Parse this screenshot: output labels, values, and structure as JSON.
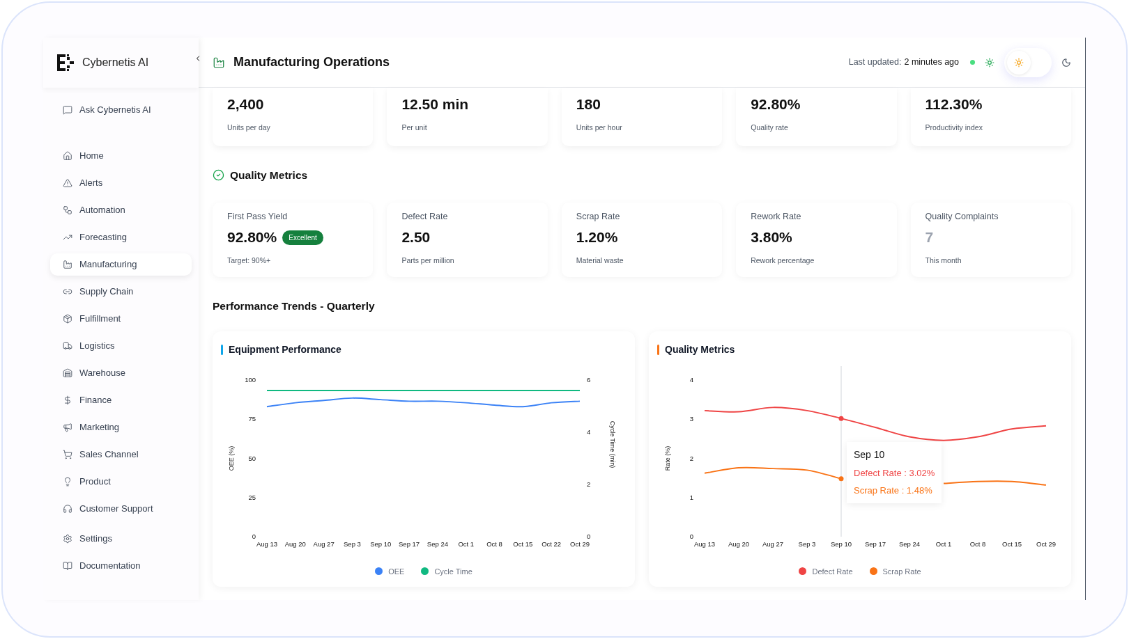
{
  "brand": {
    "name": "Cybernetis AI"
  },
  "sidebar": {
    "top_items": [
      {
        "label": "Ask Cybernetis AI",
        "selected": false
      }
    ],
    "items": [
      {
        "label": "Home",
        "selected": false
      },
      {
        "label": "Alerts",
        "selected": false
      },
      {
        "label": "Automation",
        "selected": false
      },
      {
        "label": "Forecasting",
        "selected": false
      },
      {
        "label": "Manufacturing",
        "selected": true
      },
      {
        "label": "Supply Chain",
        "selected": false
      },
      {
        "label": "Fulfillment",
        "selected": false
      },
      {
        "label": "Logistics",
        "selected": false
      },
      {
        "label": "Warehouse",
        "selected": false
      },
      {
        "label": "Finance",
        "selected": false
      },
      {
        "label": "Marketing",
        "selected": false
      },
      {
        "label": "Sales Channel",
        "selected": false
      },
      {
        "label": "Product",
        "selected": false
      },
      {
        "label": "Customer Support",
        "selected": false
      }
    ],
    "bottom_items": [
      {
        "label": "Settings",
        "selected": false
      },
      {
        "label": "Documentation",
        "selected": false
      }
    ]
  },
  "header": {
    "title": "Manufacturing Operations",
    "updated_label": "Last updated:",
    "updated_value": "2 minutes ago",
    "dark_mode": false
  },
  "production_cards": [
    {
      "value": "2,400",
      "sub": "Units per day"
    },
    {
      "value": "12.50 min",
      "sub": "Per unit"
    },
    {
      "value": "180",
      "sub": "Units per hour"
    },
    {
      "value": "92.80%",
      "sub": "Quality rate"
    },
    {
      "value": "112.30%",
      "sub": "Productivity index"
    }
  ],
  "quality": {
    "title": "Quality Metrics",
    "cards": [
      {
        "label": "First Pass Yield",
        "value": "92.80%",
        "badge": "Excellent",
        "sub": "Target: 90%+",
        "faded": false
      },
      {
        "label": "Defect Rate",
        "value": "2.50",
        "sub": "Parts per million",
        "faded": false
      },
      {
        "label": "Scrap Rate",
        "value": "1.20%",
        "sub": "Material waste",
        "faded": false
      },
      {
        "label": "Rework Rate",
        "value": "3.80%",
        "sub": "Rework percentage",
        "faded": false
      },
      {
        "label": "Quality Complaints",
        "value": "7",
        "sub": "This month",
        "faded": true
      }
    ]
  },
  "trends": {
    "title": "Performance Trends - Quarterly",
    "charts": [
      {
        "title": "Equipment Performance",
        "color": "#0ea5e9",
        "chart_data": {
          "type": "line",
          "ylabel": "OEE (%)",
          "y2label": "Cycle Time (min)",
          "categories": [
            "Aug 13",
            "Aug 20",
            "Aug 27",
            "Sep 3",
            "Sep 10",
            "Sep 17",
            "Sep 24",
            "Oct 1",
            "Oct 8",
            "Oct 15",
            "Oct 22",
            "Oct 29"
          ],
          "ylim": [
            0,
            100
          ],
          "yticks": [
            0,
            25,
            50,
            75,
            100
          ],
          "y2lim": [
            0,
            6
          ],
          "y2ticks": [
            0,
            2,
            4,
            6
          ],
          "series": [
            {
              "name": "OEE",
              "color": "#3b82f6",
              "values": [
                83,
                85.5,
                87,
                88.5,
                87.5,
                86.5,
                86.5,
                85.5,
                84,
                83,
                85.5,
                86.5
              ]
            },
            {
              "name": "Cycle Time",
              "color": "#10b981",
              "axis": "y2",
              "values": [
                5.6,
                5.6,
                5.6,
                5.6,
                5.6,
                5.6,
                5.6,
                5.6,
                5.6,
                5.6,
                5.6,
                5.6
              ]
            }
          ]
        }
      },
      {
        "title": "Quality Metrics",
        "color": "#f97316",
        "chart_data": {
          "type": "line",
          "ylabel": "Rate (%)",
          "categories": [
            "Aug 13",
            "Aug 20",
            "Aug 27",
            "Sep 3",
            "Sep 10",
            "Sep 17",
            "Sep 24",
            "Oct 1",
            "Oct 8",
            "Oct 15",
            "Oct 29"
          ],
          "ylim": [
            0,
            4
          ],
          "yticks": [
            0,
            1,
            2,
            3,
            4
          ],
          "series": [
            {
              "name": "Defect Rate",
              "color": "#ef4444",
              "values": [
                3.22,
                3.19,
                3.3,
                3.22,
                3.02,
                2.79,
                2.55,
                2.46,
                2.55,
                2.75,
                2.83
              ]
            },
            {
              "name": "Scrap Rate",
              "color": "#f97316",
              "values": [
                1.62,
                1.76,
                1.74,
                1.7,
                1.48,
                null,
                null,
                1.36,
                1.41,
                1.41,
                1.32
              ]
            }
          ]
        },
        "hovered": [
          false,
          false,
          false,
          false,
          true,
          false,
          false,
          false,
          false,
          false,
          false
        ],
        "tooltip": {
          "title": "Sep 10",
          "lines": [
            {
              "text": "Defect Rate : 3.02%",
              "color": "#ef4444"
            },
            {
              "text": "Scrap Rate : 1.48%",
              "color": "#f97316"
            }
          ]
        }
      }
    ]
  }
}
